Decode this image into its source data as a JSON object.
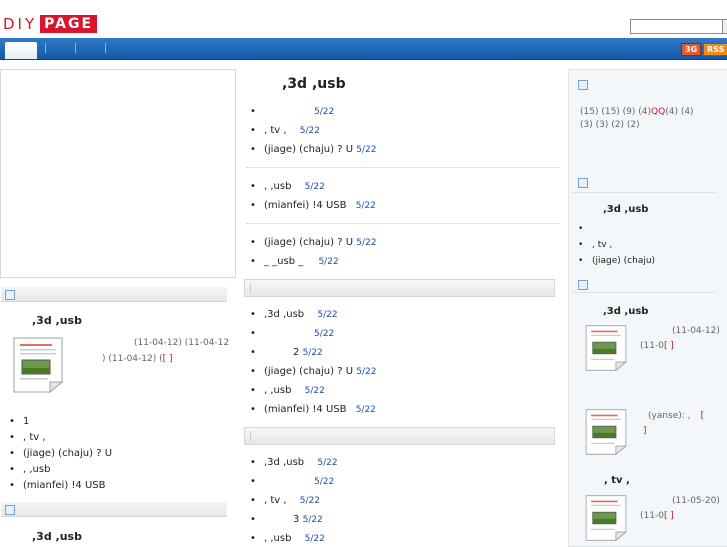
{
  "header": {
    "logo_left": "DIY",
    "logo_right": "PAGE",
    "search_placeholder": "",
    "badge_3g": "3G",
    "badge_rss": "RSS"
  },
  "nav": {
    "tabs": [
      "",
      "",
      "",
      ""
    ]
  },
  "center": {
    "title": ",3d     ,usb",
    "group1": [
      {
        "text": "",
        "date": "5/22"
      },
      {
        "text": " ,  tv   ,",
        "date": "5/22"
      },
      {
        "text": "(jiage)  (chaju)     ? U",
        "date": "5/22"
      }
    ],
    "group2": [
      {
        "text": " ,      ,usb",
        "date": "5/22"
      },
      {
        "text": "(mianfei)      !4 USB",
        "date": "5/22"
      }
    ],
    "group3": [
      {
        "text": "(jiage)  (chaju)     ? U",
        "date": "5/22"
      },
      {
        "text": " _     _usb   _",
        "date": "5/22"
      }
    ],
    "group4": [
      {
        "text": ",3d    ,usb",
        "date": "5/22"
      },
      {
        "text": "",
        "date": "5/22"
      },
      {
        "text": "2",
        "date": "5/22"
      },
      {
        "text": "(jiage)  (chaju)     ? U",
        "date": "5/22"
      },
      {
        "text": " ,      ,usb",
        "date": "5/22"
      },
      {
        "text": "(mianfei)      !4 USB",
        "date": "5/22"
      }
    ],
    "group5": [
      {
        "text": ",3d    ,usb",
        "date": "5/22"
      },
      {
        "text": "",
        "date": "5/22"
      },
      {
        "text": " ,   tv   ,",
        "date": "5/22"
      },
      {
        "text": "3",
        "date": "5/22"
      },
      {
        "text": " ,      ,usb",
        "date": "5/22"
      }
    ]
  },
  "left": {
    "post_title": ",3d     ,usb",
    "post_meta_a": "(11-04-12) (11-04-12",
    "post_meta_b": ") (11-04-12) (",
    "post_meta_link": "[ ]",
    "list": [
      "1",
      " ,  tv   ,",
      "(jiage)  (chaju)     ? U",
      " ,      ,usb",
      "(mianfei)      !4 USB"
    ],
    "post_title_2": ",3d     ,usb"
  },
  "right": {
    "tags_line1": "(15)  (15)  (9)  (4)",
    "tags_qq": "QQ",
    "tags_line1_end": "(4)   (4)",
    "tags_line2": "(3)  (3)  (2)  (2)",
    "section2_title": ",3d     ,usb",
    "section2_list": [
      "",
      " ,  tv   ,",
      "(jiage)  (chaju)"
    ],
    "section3_title": ",3d     ,usb",
    "post1_meta": "(11-04-12)",
    "post1_meta2": "(11-0",
    "post1_link": "[ ]",
    "post2_meta": "(yanse):       ,",
    "post2_link1": "[",
    "post2_link2": "]",
    "post3_title": ",  tv     ,",
    "post3_meta": "(11-05-20)",
    "post3_meta2": "(11-0",
    "post3_link": "[ ]"
  }
}
